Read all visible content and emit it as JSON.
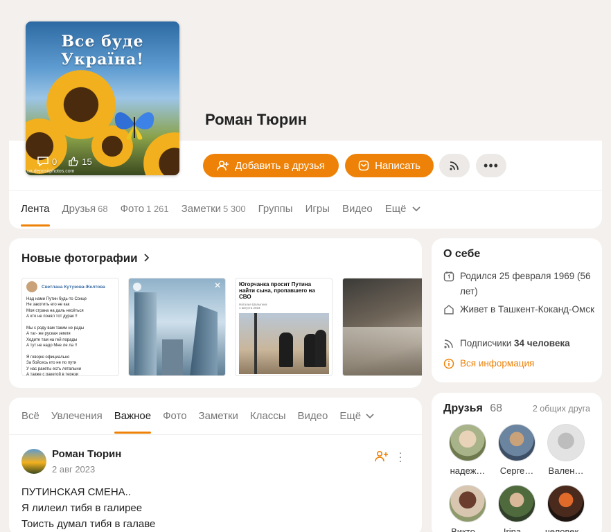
{
  "profile": {
    "name": "Роман Тюрин",
    "avatar_slogan": "Все буде Україна!",
    "avatar_comments": "0",
    "avatar_likes": "15",
    "avatar_watermark": "ua.depositphotos.com"
  },
  "actions": {
    "add_friend": "Добавить в друзья",
    "write": "Написать"
  },
  "nav": {
    "items": [
      {
        "label": "Лента",
        "count": ""
      },
      {
        "label": "Друзья",
        "count": "68"
      },
      {
        "label": "Фото",
        "count": "1 261"
      },
      {
        "label": "Заметки",
        "count": "5 300"
      },
      {
        "label": "Группы",
        "count": ""
      },
      {
        "label": "Игры",
        "count": ""
      },
      {
        "label": "Видео",
        "count": ""
      },
      {
        "label": "Ещё",
        "count": ""
      }
    ]
  },
  "photos": {
    "title": "Новые фотографии",
    "photo1": {
      "author": "Светлана Кутузова-Желтова",
      "lines": [
        "Над нами Путин будь-то Сонце",
        "Не закотить его не как",
        "Моя страна на даль несёться",
        "А кто не понял тот дурак !!",
        "",
        "Мы с роду вам таким не рады",
        "А таг- же руская земля",
        "Ходите там на гей порады",
        "А тут не надо Мне ле ла !!",
        "",
        "Я говорю официально",
        "За бойсесь кто не по пути",
        "У нас ракеты есть леталыни",
        "А также с ракетой в терези"
      ]
    },
    "photo3": {
      "headline": "Югорчанка просит Путина найти сына, пропавшего на СВО",
      "meta1": "Наталья Шалыгина",
      "meta2": "1 августа 2023"
    }
  },
  "about": {
    "title": "О себе",
    "born": "Родился 25 февраля 1969 (56 лет)",
    "lives": "Живет в Ташкент-Коканд-Омск",
    "subscribers_label": "Подписчики",
    "subscribers_value": "34 человека",
    "all_info": "Вся информация"
  },
  "feed": {
    "tabs": [
      "Всё",
      "Увлечения",
      "Важное",
      "Фото",
      "Заметки",
      "Классы",
      "Видео",
      "Ещё"
    ],
    "active_tab": "Важное",
    "post": {
      "author": "Роман Тюрин",
      "date": "2 авг 2023",
      "lines": [
        "ПУТИНСКАЯ СМЕНА..",
        "Я лилеил тибя в галирее",
        "Тоисть думал тибя в галаве"
      ]
    }
  },
  "friends": {
    "title": "Друзья",
    "count": "68",
    "mutual": "2 общих друга",
    "items": [
      {
        "name": "надеж…"
      },
      {
        "name": "Серге…"
      },
      {
        "name": "Вален…"
      },
      {
        "name": "Викто…"
      },
      {
        "name": "Irina…"
      },
      {
        "name": "человек…"
      }
    ]
  },
  "colors": {
    "accent": "#ee8208",
    "background": "#f4f0ee",
    "card": "#ffffff"
  }
}
